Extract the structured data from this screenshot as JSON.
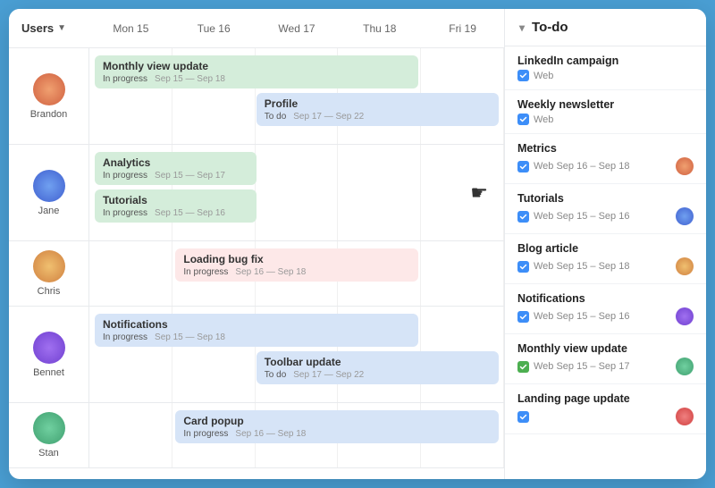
{
  "header": {
    "users_label": "Users",
    "days": [
      {
        "label": "Mon 15"
      },
      {
        "label": "Tue 16"
      },
      {
        "label": "Wed 17"
      },
      {
        "label": "Thu 18"
      },
      {
        "label": "Fri 19"
      }
    ]
  },
  "users": [
    {
      "name": "Brandon",
      "avatar_class": "av-brandon",
      "tasks": [
        {
          "title": "Monthly view update",
          "status": "In progress",
          "dates": "Sep 15 — Sep 18",
          "color": "green",
          "col_start": 0,
          "col_span": 4
        },
        {
          "title": "Profile",
          "status": "To do",
          "dates": "Sep 17 — Sep 22",
          "color": "blue",
          "col_start": 2,
          "col_span": 3
        }
      ]
    },
    {
      "name": "Jane",
      "avatar_class": "av-jane",
      "tasks": [
        {
          "title": "Analytics",
          "status": "In progress",
          "dates": "Sep 15 — Sep 17",
          "color": "green",
          "col_start": 0,
          "col_span": 2
        },
        {
          "title": "Tutorials",
          "status": "In progress",
          "dates": "Sep 15 — Sep 16",
          "color": "green",
          "col_start": 0,
          "col_span": 2
        }
      ]
    },
    {
      "name": "Chris",
      "avatar_class": "av-chris",
      "tasks": [
        {
          "title": "Loading bug fix",
          "status": "In progress",
          "dates": "Sep 16 — Sep 18",
          "color": "pink",
          "col_start": 1,
          "col_span": 3
        }
      ]
    },
    {
      "name": "Bennet",
      "avatar_class": "av-bennet",
      "tasks": [
        {
          "title": "Notifications",
          "status": "In progress",
          "dates": "Sep 15 — Sep 18",
          "color": "blue",
          "col_start": 0,
          "col_span": 4
        },
        {
          "title": "Toolbar update",
          "status": "To do",
          "dates": "Sep 17 — Sep 22",
          "color": "blue",
          "col_start": 2,
          "col_span": 3
        }
      ]
    },
    {
      "name": "Stan",
      "avatar_class": "av-stan",
      "tasks": [
        {
          "title": "Card popup",
          "status": "In progress",
          "dates": "Sep 16 — Sep 18",
          "color": "blue",
          "col_start": 1,
          "col_span": 4
        }
      ]
    }
  ],
  "todo": {
    "header": "To-do",
    "items": [
      {
        "title": "LinkedIn campaign",
        "meta": "Web",
        "has_avatar": false,
        "avatar_class": "",
        "checkbox": "blue"
      },
      {
        "title": "Weekly newsletter",
        "meta": "Web",
        "has_avatar": false,
        "avatar_class": "",
        "checkbox": "blue"
      },
      {
        "title": "Metrics",
        "meta": "Web  Sep 16 – Sep 18",
        "has_avatar": true,
        "avatar_class": "av-sm1",
        "checkbox": "blue"
      },
      {
        "title": "Tutorials",
        "meta": "Web  Sep 15 – Sep 16",
        "has_avatar": true,
        "avatar_class": "av-sm2",
        "checkbox": "blue"
      },
      {
        "title": "Blog article",
        "meta": "Web  Sep 15 – Sep 18",
        "has_avatar": true,
        "avatar_class": "av-sm3",
        "checkbox": "blue"
      },
      {
        "title": "Notifications",
        "meta": "Web  Sep 15 – Sep 16",
        "has_avatar": true,
        "avatar_class": "av-sm4",
        "checkbox": "blue"
      },
      {
        "title": "Monthly view update",
        "meta": "Web  Sep 15 – Sep 17",
        "has_avatar": true,
        "avatar_class": "av-sm5",
        "checkbox": "green"
      },
      {
        "title": "Landing page update",
        "meta": "",
        "has_avatar": true,
        "avatar_class": "av-sm6",
        "checkbox": "blue"
      }
    ]
  }
}
